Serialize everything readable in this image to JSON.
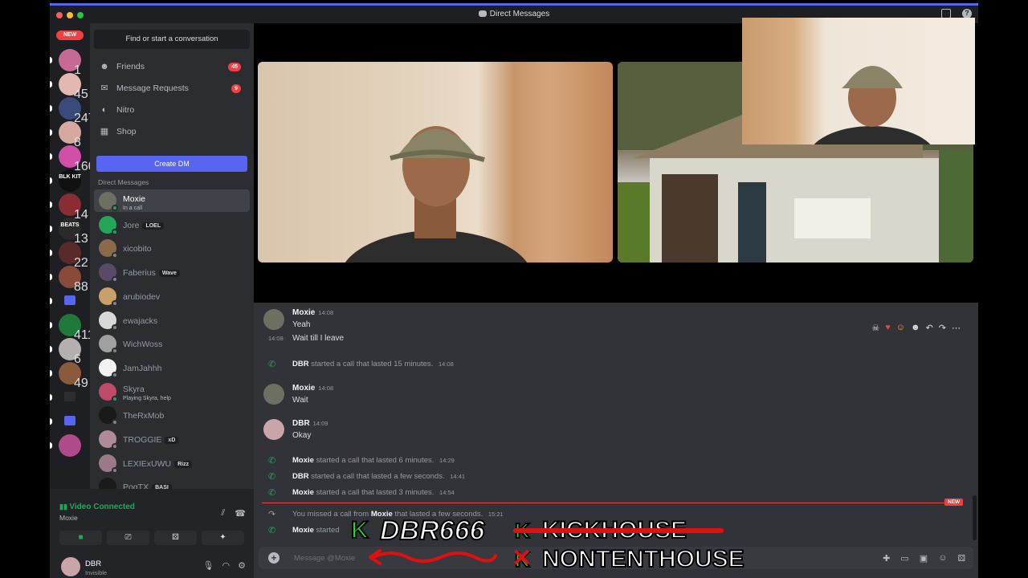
{
  "window": {
    "title": "Direct Messages"
  },
  "rail": {
    "new_badge": "NEW",
    "servers": [
      {
        "count": "1",
        "color": "#c46a93"
      },
      {
        "count": "45",
        "color": "#e3b8b0"
      },
      {
        "count": "247",
        "color": "#3a4a7a"
      },
      {
        "count": "8",
        "color": "#d6a8a0"
      },
      {
        "count": "160",
        "color": "#d24fa7"
      },
      {
        "label": "BLK KIT",
        "color": "#111"
      },
      {
        "count": "14",
        "color": "#8a2d33"
      },
      {
        "label": "BEATS",
        "count": "13",
        "color": "#2a2a2a"
      },
      {
        "count": "22",
        "color": "#5a2a2a"
      },
      {
        "count": "88",
        "color": "#8a4a3a"
      },
      {
        "icon": "folder-icon",
        "color": "#5865f2"
      },
      {
        "count": "411",
        "color": "#1f7a3a"
      },
      {
        "count": "6",
        "color": "#b5b0b0"
      },
      {
        "count": "49",
        "color": "#8a5a3a"
      },
      {
        "icon": "robot-icon",
        "color": "#2b2d31"
      },
      {
        "icon": "folder-icon",
        "color": "#5865f2"
      },
      {
        "color": "#b04a8a"
      }
    ]
  },
  "sidebar": {
    "search_placeholder": "Find or start a conversation",
    "nav": [
      {
        "label": "Friends",
        "icon": "friends-icon",
        "badge": "45"
      },
      {
        "label": "Message Requests",
        "icon": "envelope-icon",
        "badge": "9"
      },
      {
        "label": "Nitro",
        "icon": "nitro-icon",
        "badge": ""
      },
      {
        "label": "Shop",
        "icon": "shop-icon",
        "badge": ""
      }
    ],
    "create_dm": "Create DM",
    "dm_header": "Direct Messages",
    "dms": [
      {
        "name": "Moxie",
        "sub": "In a call",
        "tag": "",
        "color": "#6d7060",
        "status": "online"
      },
      {
        "name": "Jore",
        "sub": "",
        "tag": "LOEL",
        "color": "#23a55a",
        "status": "online"
      },
      {
        "name": "xicobito",
        "sub": "",
        "tag": "",
        "color": "#8a6a4a",
        "status": "idle"
      },
      {
        "name": "Faberius",
        "sub": "",
        "tag": "Wave",
        "color": "#5a4a6a",
        "status": "idle"
      },
      {
        "name": "arubiodev",
        "sub": "",
        "tag": "",
        "color": "#c9a06a",
        "status": "idle"
      },
      {
        "name": "ewajacks",
        "sub": "",
        "tag": "",
        "color": "#d8d8d8",
        "status": "idle"
      },
      {
        "name": "WichWoss",
        "sub": "",
        "tag": "",
        "color": "#a0a0a0",
        "status": "idle"
      },
      {
        "name": "JamJahhh",
        "sub": "",
        "tag": "",
        "color": "#f2f2f2",
        "status": "idle"
      },
      {
        "name": "Skyra",
        "sub": "Playing Skyra, help",
        "tag": "",
        "color": "#c04a6a",
        "status": "online"
      },
      {
        "name": "TheRxMob",
        "sub": "",
        "tag": "",
        "color": "#1a1a1a",
        "status": "idle"
      },
      {
        "name": "TROGGIE",
        "sub": "",
        "tag": "xD",
        "color": "#b08a9a",
        "status": "idle"
      },
      {
        "name": "LEXIExUWU",
        "sub": "",
        "tag": "Rizz",
        "color": "#9a7a8a",
        "status": "idle"
      },
      {
        "name": "PogTX",
        "sub": "",
        "tag": "BASI",
        "color": "#1a1a1a",
        "status": "idle"
      }
    ]
  },
  "voice": {
    "title": "Video Connected",
    "channel": "Moxie",
    "user_name": "DBR",
    "user_status": "Invisible"
  },
  "chat": {
    "messages": [
      {
        "author": "Moxie",
        "time": "14:08",
        "text": "Yeah"
      },
      {
        "time": "14:08",
        "text": "Wait till I leave"
      },
      {
        "system": "started a call that lasted 15 minutes.",
        "who": "DBR",
        "time": "14:08"
      },
      {
        "author": "Moxie",
        "time": "14:08",
        "text": "Wait"
      },
      {
        "author": "DBR",
        "time": "14:09",
        "text": "Okay"
      },
      {
        "system": "started a call that lasted 6 minutes.",
        "who": "Moxie",
        "time": "14:29"
      },
      {
        "system": "started a call that lasted a few seconds.",
        "who": "DBR",
        "time": "14:41"
      },
      {
        "system": "started a call that lasted 3 minutes.",
        "who": "Moxie",
        "time": "14:54"
      },
      {
        "system_pre": "You missed a call from",
        "who": "Moxie",
        "system": "that lasted a few seconds.",
        "time": "15:21"
      },
      {
        "system": "started",
        "who": "Moxie"
      }
    ],
    "new_marker": "NEW",
    "composer_placeholder": "Message @Moxie"
  },
  "overlay": {
    "name": "DBR666",
    "crossed": "KICKHOUSE",
    "house": "NONTENTHOUSE"
  },
  "colors": {
    "accent": "#5865f2",
    "online": "#23a55a",
    "danger": "#f23f43"
  }
}
